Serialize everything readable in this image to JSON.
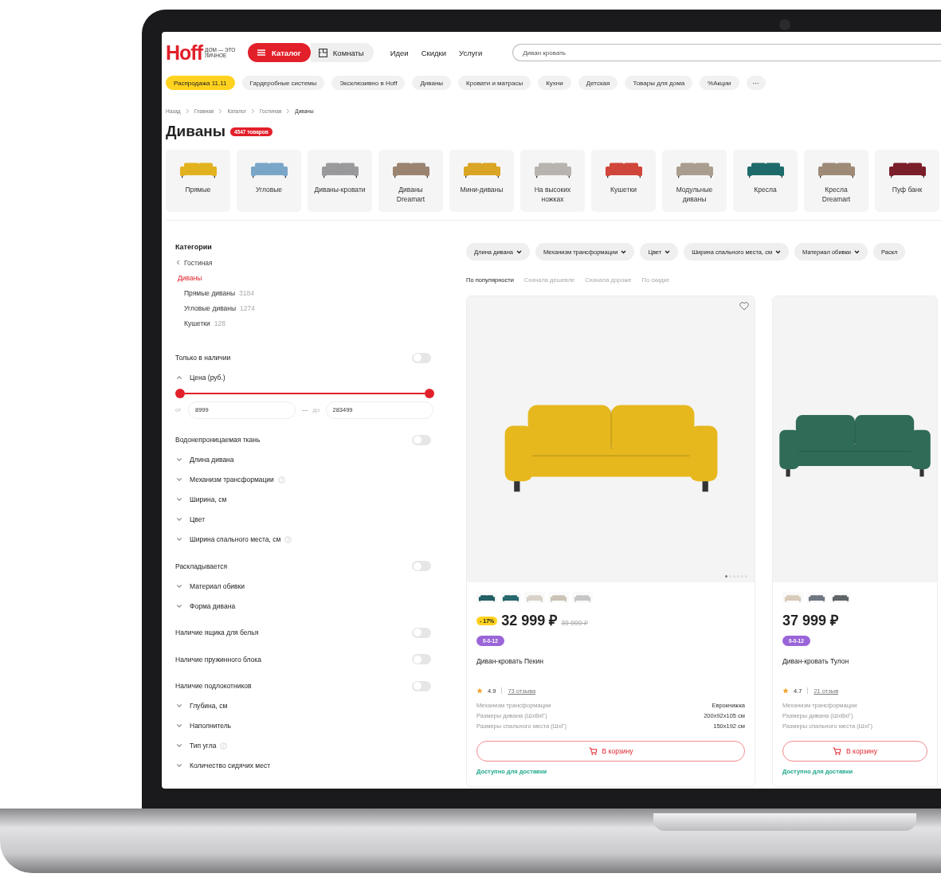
{
  "header": {
    "logo": "Hoff",
    "tagline": "ДОМ — ЭТО ЛИЧНОЕ",
    "catalog_button": "Каталог",
    "rooms_button": "Комнаты",
    "links": [
      "Идеи",
      "Скидки",
      "Услуги"
    ],
    "search": {
      "placeholder": "Диван кровать"
    }
  },
  "promo_chips": [
    {
      "label": "Распродажа 11.11",
      "kind": "highlight"
    },
    {
      "label": "Гардеробные системы",
      "kind": "plain"
    },
    {
      "label": "Эксклюзивно в Hoff",
      "kind": "plain"
    },
    {
      "label": "Диваны",
      "kind": "plain"
    },
    {
      "label": "Кровати и матрасы",
      "kind": "plain"
    },
    {
      "label": "Кухни",
      "kind": "plain"
    },
    {
      "label": "Детская",
      "kind": "plain"
    },
    {
      "label": "Товары для дома",
      "kind": "plain"
    },
    {
      "label": "%Акции",
      "kind": "plain"
    },
    {
      "label": "···",
      "kind": "more"
    }
  ],
  "breadcrumbs": [
    "Назад",
    "Главная",
    "Каталог",
    "Гостиная",
    "Диваны"
  ],
  "title": "Диваны",
  "count_badge": "4547 товаров",
  "categories": [
    {
      "label": "Прямые",
      "color": "#e2b21f"
    },
    {
      "label": "Угловые",
      "color": "#7aa6c8"
    },
    {
      "label": "Диваны-кровати",
      "color": "#9a9a9c"
    },
    {
      "label": "Диваны Dreamart",
      "color": "#9b8470"
    },
    {
      "label": "Мини-диваны",
      "color": "#dba525"
    },
    {
      "label": "На высоких ножках",
      "color": "#b8b4b0"
    },
    {
      "label": "Кушетки",
      "color": "#d0463a"
    },
    {
      "label": "Модульные диваны",
      "color": "#a99e8f"
    },
    {
      "label": "Кресла",
      "color": "#1e6b6b"
    },
    {
      "label": "Кресла Dreamart",
      "color": "#9e8a76"
    },
    {
      "label": "Пуф банк",
      "color": "#7a1e2a"
    }
  ],
  "sidebar": {
    "heading": "Категории",
    "back_link": "Гостиная",
    "current": "Диваны",
    "subcategories": [
      {
        "label": "Прямые диваны",
        "count": "3184"
      },
      {
        "label": "Угловые диваны",
        "count": "1274"
      },
      {
        "label": "Кушетки",
        "count": "128"
      }
    ],
    "filters": [
      {
        "kind": "toggle",
        "label": "Только в наличии",
        "on": false
      },
      {
        "kind": "price",
        "label": "Цена (руб.)",
        "expanded": true,
        "thumbs": [
          {
            "level": 0
          },
          {
            "level": 1
          }
        ],
        "from_label": "от",
        "from_value": "8999",
        "separator": "—",
        "to_label": "до",
        "to_value": "283499"
      },
      {
        "kind": "toggle",
        "label": "Водонепроницаемая ткань",
        "on": false
      },
      {
        "kind": "expander",
        "label": "Длина дивана",
        "expanded": false
      },
      {
        "kind": "expander",
        "label": "Механизм трансформации",
        "expanded": false,
        "info": true
      },
      {
        "kind": "expander",
        "label": "Ширина, см",
        "expanded": false
      },
      {
        "kind": "expander",
        "label": "Цвет",
        "expanded": false
      },
      {
        "kind": "expander",
        "label": "Ширина спального места, см",
        "expanded": false,
        "info": true
      },
      {
        "kind": "toggle",
        "label": "Раскладывается",
        "on": false
      },
      {
        "kind": "expander",
        "label": "Материал обивки",
        "expanded": false
      },
      {
        "kind": "expander",
        "label": "Форма дивана",
        "expanded": false
      },
      {
        "kind": "toggle",
        "label": "Наличие ящика для белья",
        "on": false
      },
      {
        "kind": "toggle",
        "label": "Наличие пружинного блока",
        "on": false
      },
      {
        "kind": "toggle",
        "label": "Наличие подлокотников",
        "on": false
      },
      {
        "kind": "expander",
        "label": "Глубина, см",
        "expanded": false
      },
      {
        "kind": "expander",
        "label": "Наполнитель",
        "expanded": false
      },
      {
        "kind": "expander",
        "label": "Тип угла",
        "expanded": false,
        "info": true
      },
      {
        "kind": "expander",
        "label": "Количество сидячих мест",
        "expanded": false
      }
    ]
  },
  "filter_chips": [
    {
      "label": "Длина дивана",
      "caret": true
    },
    {
      "label": "Механизм трансформации",
      "caret": true
    },
    {
      "label": "Цвет",
      "caret": true
    },
    {
      "label": "Ширина спального места, см",
      "caret": true
    },
    {
      "label": "Материал обивки",
      "caret": true
    },
    {
      "label": "Раскл",
      "caret": false
    }
  ],
  "sort_options": [
    {
      "label": "По популярности",
      "selected": true
    },
    {
      "label": "Сначала дешевле",
      "selected": false
    },
    {
      "label": "Сначала дороже",
      "selected": false
    },
    {
      "label": "По скидке",
      "selected": false
    }
  ],
  "products": [
    {
      "color": "#e6b81e",
      "favorite_icon": true,
      "image_dots": [
        {
          "selected": true
        },
        {
          "selected": false
        },
        {
          "selected": false
        },
        {
          "selected": false
        },
        {
          "selected": false
        },
        {
          "selected": false
        }
      ],
      "swatches": [
        {
          "color": "#1f5e63"
        },
        {
          "color": "#24666b"
        },
        {
          "color": "#d8d2c8"
        },
        {
          "color": "#cbc3b5"
        },
        {
          "color": "#c6c6c6"
        }
      ],
      "discount": "- 17%",
      "price": "32 999 ₽",
      "old_price": "39 999 ₽",
      "installment": "0-0-12",
      "name": "Диван-кровать Пекин",
      "rating": "4.9",
      "reviews": "73 отзыва",
      "specs": [
        {
          "label": "Механизм трансформации",
          "value": "Еврокнижка"
        },
        {
          "label": "Размеры дивана (ШхВхГ)",
          "value": "200x92x105 см"
        },
        {
          "label": "Размеры спального места (ШхГ)",
          "value": "150x192 см"
        }
      ],
      "button": "В корзину",
      "availability": "Доступно для доставки"
    },
    {
      "color": "#2f6b57",
      "swatches": [
        {
          "color": "#d8cbb8"
        },
        {
          "color": "#6d7580"
        },
        {
          "color": "#5c6266"
        }
      ],
      "price": "37 999 ₽",
      "installment": "0-0-12",
      "name": "Диван-кровать Тулон",
      "rating": "4.7",
      "reviews": "21 отзыв",
      "specs": [
        {
          "label": "Механизм трансформации"
        },
        {
          "label": "Размеры дивана (ШхВхГ)"
        },
        {
          "label": "Размеры спального места (ШхГ)"
        }
      ],
      "button": "В корзину",
      "availability": "Доступно для доставки"
    }
  ]
}
